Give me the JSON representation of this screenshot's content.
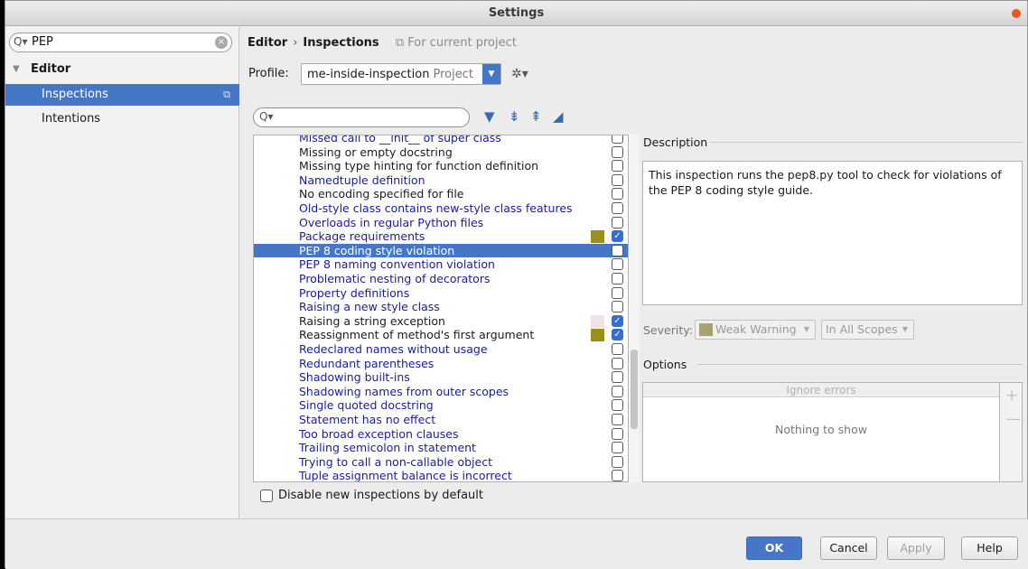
{
  "window": {
    "title": "Settings"
  },
  "sidebar": {
    "search_value": "PEP",
    "items": [
      {
        "label": "Editor",
        "arrow": "▼"
      },
      {
        "label": "Inspections"
      },
      {
        "label": "Intentions"
      }
    ]
  },
  "breadcrumb": {
    "root": "Editor",
    "separator": "›",
    "current": "Inspections",
    "scope_note": "For current project"
  },
  "profile": {
    "label": "Profile:",
    "value": "me-inside-inspection",
    "scope": "Project"
  },
  "inspections": [
    {
      "name": "Missed call to __init__ of super class",
      "blue": true,
      "checked": false
    },
    {
      "name": "Missing or empty docstring",
      "blue": false,
      "checked": false
    },
    {
      "name": "Missing type hinting for function definition",
      "blue": false,
      "checked": false
    },
    {
      "name": "Namedtuple definition",
      "blue": true,
      "checked": false
    },
    {
      "name": "No encoding specified for file",
      "blue": false,
      "checked": false
    },
    {
      "name": "Old-style class contains new-style class features",
      "blue": true,
      "checked": false
    },
    {
      "name": "Overloads in regular Python files",
      "blue": true,
      "checked": false
    },
    {
      "name": "Package requirements",
      "blue": true,
      "checked": true,
      "swatch": "#9a8f1a"
    },
    {
      "name": "PEP 8 coding style violation",
      "blue": true,
      "checked": false,
      "selected": true
    },
    {
      "name": "PEP 8 naming convention violation",
      "blue": true,
      "checked": false
    },
    {
      "name": "Problematic nesting of decorators",
      "blue": true,
      "checked": false
    },
    {
      "name": "Property definitions",
      "blue": true,
      "checked": false
    },
    {
      "name": "Raising a new style class",
      "blue": true,
      "checked": false
    },
    {
      "name": "Raising a string exception",
      "blue": false,
      "checked": true,
      "swatch": "#f4e1e4"
    },
    {
      "name": "Reassignment of method's first argument",
      "blue": false,
      "checked": true,
      "swatch": "#9a8f1a"
    },
    {
      "name": "Redeclared names without usage",
      "blue": true,
      "checked": false
    },
    {
      "name": "Redundant parentheses",
      "blue": true,
      "checked": false
    },
    {
      "name": "Shadowing built-ins",
      "blue": true,
      "checked": false
    },
    {
      "name": "Shadowing names from outer scopes",
      "blue": true,
      "checked": false
    },
    {
      "name": "Single quoted docstring",
      "blue": true,
      "checked": false
    },
    {
      "name": "Statement has no effect",
      "blue": true,
      "checked": false
    },
    {
      "name": "Too broad exception clauses",
      "blue": true,
      "checked": false
    },
    {
      "name": "Trailing semicolon in statement",
      "blue": true,
      "checked": false
    },
    {
      "name": "Trying to call a non-callable object",
      "blue": true,
      "checked": false
    },
    {
      "name": "Tuple assignment balance is incorrect",
      "blue": true,
      "checked": false
    }
  ],
  "description": {
    "title": "Description",
    "text": "This inspection runs the pep8.py tool to check for violations of the PEP 8 coding style guide."
  },
  "severity": {
    "label": "Severity:",
    "value": "Weak Warning",
    "scope": "In All Scopes",
    "swatch": "#a8a272"
  },
  "options": {
    "title": "Options",
    "column_header": "Ignore errors",
    "empty_text": "Nothing to show"
  },
  "disable_new": {
    "label": "Disable new inspections by default",
    "checked": false
  },
  "buttons": {
    "ok": "OK",
    "cancel": "Cancel",
    "apply": "Apply",
    "help": "Help"
  },
  "colors": {
    "accent": "#4577c6",
    "link": "#1c1c9a",
    "close": "#e95420"
  }
}
